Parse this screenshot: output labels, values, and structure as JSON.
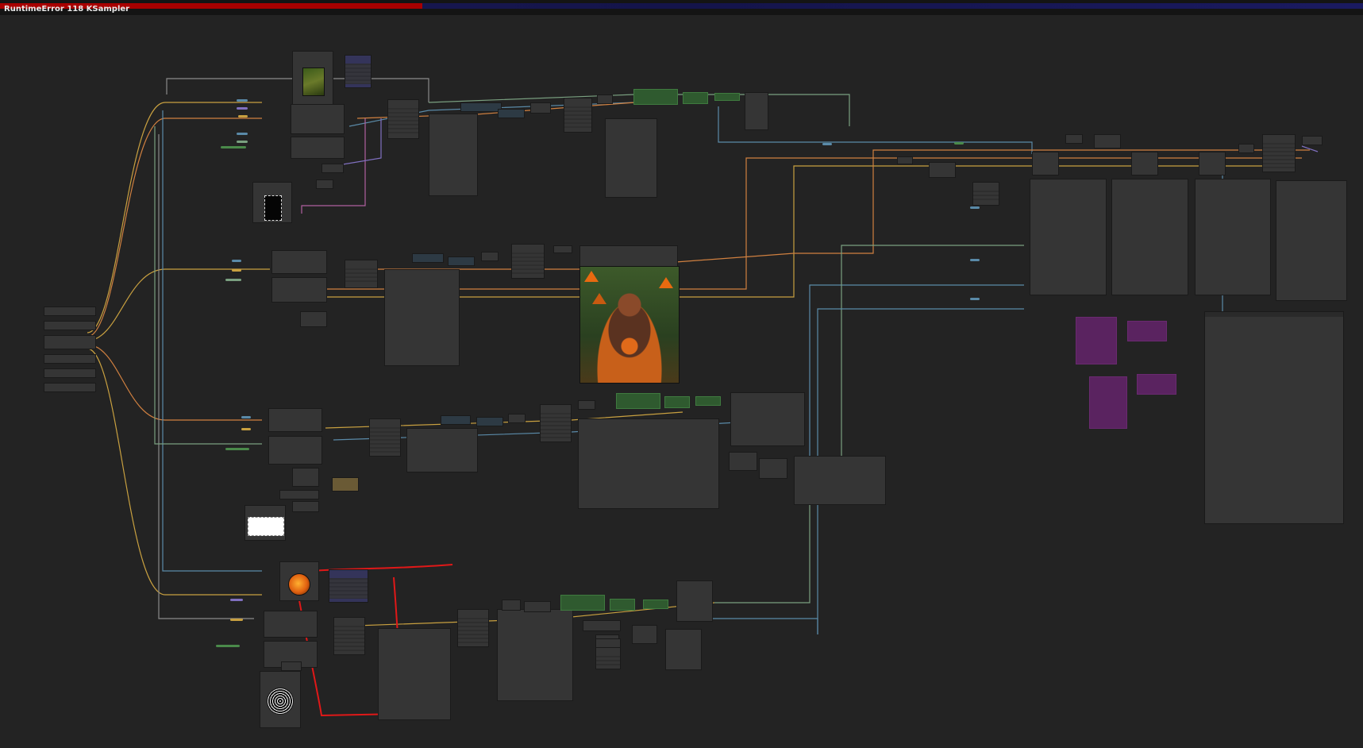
{
  "app": {
    "error_title": "RuntimeError 118 KSampler",
    "queue_progress_percent": 31
  },
  "colors": {
    "canvas_bg": "#232323",
    "node_bg": "#353535",
    "error_bar": "#a80000",
    "annotation_red": "#e01818",
    "link_yellow": "#c8a040",
    "link_orange": "#d08040",
    "link_blue": "#5a8aa8",
    "link_pink": "#b060a0",
    "link_purple": "#8070c0",
    "node_green": "#2f5a2f",
    "node_purple": "#5a2360"
  },
  "icons": [
    "image-thumbnail",
    "mask-thumbnail",
    "orb-thumbnail",
    "noise-thumbnail",
    "portrait-output-image"
  ]
}
